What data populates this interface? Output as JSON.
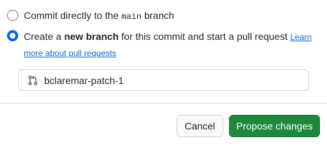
{
  "option_direct": {
    "prefix": "Commit directly to the ",
    "branch_code": "main",
    "suffix": " branch",
    "checked": false
  },
  "option_new_branch": {
    "prefix": "Create a ",
    "bold": "new branch",
    "suffix": " for this commit and start a pull request ",
    "link": "Learn more about pull requests",
    "checked": true
  },
  "branch_input": {
    "value": "bclaremar-patch-1",
    "icon": "git-pull-request-icon"
  },
  "buttons": {
    "cancel": "Cancel",
    "propose": "Propose changes"
  },
  "colors": {
    "accent": "#0969da",
    "primary_button": "#1f883d"
  }
}
